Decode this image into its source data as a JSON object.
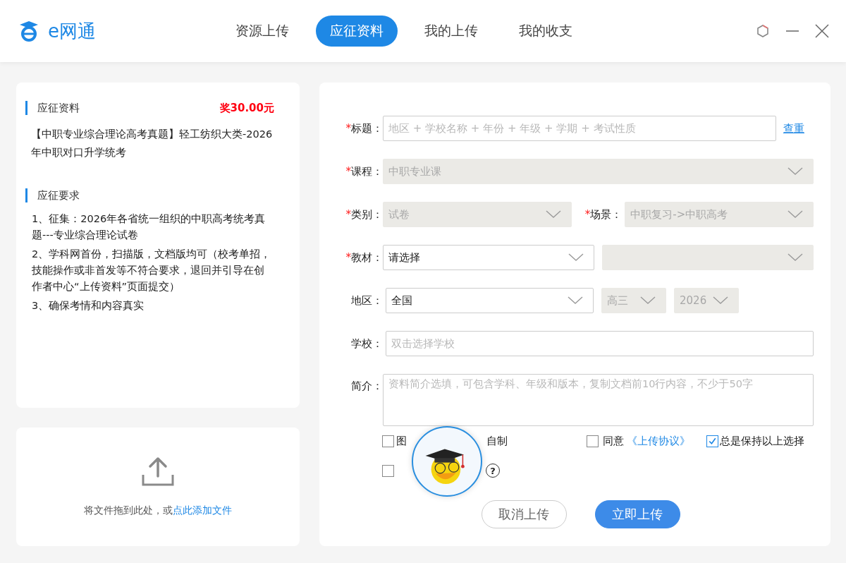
{
  "app": {
    "name": "e网通"
  },
  "nav_tabs": [
    {
      "label": "资源上传",
      "selected": false
    },
    {
      "label": "应征资料",
      "selected": true
    },
    {
      "label": "我的上传",
      "selected": false
    },
    {
      "label": "我的收支",
      "selected": false
    }
  ],
  "request": {
    "heading": "应征资料",
    "reward": "奖30.00元",
    "title": "【中职专业综合理论高考真题】轻工纺织大类-2026年中职对口升学统考",
    "requirements_heading": "应征要求",
    "requirements": [
      "1、征集：2026年各省统一组织的中职高考统考真题---专业综合理论试卷",
      "2、学科网首份，扫描版，文档版均可（校考单招，技能操作或非首发等不符合要求，退回并引导在创作者中心“上传资料”页面提交）",
      "3、确保考情和内容真实"
    ]
  },
  "upload": {
    "text": "将文件拖到此处，或",
    "link": "点此添加文件"
  },
  "form": {
    "rows": [
      {
        "fields": [
          {
            "kind": "input",
            "required_mark": "*",
            "label": "标题：",
            "placeholder": "地区 + 学校名称 + 年份 + 年级 + 学期 + 考试性质",
            "action": "查重"
          }
        ]
      },
      {
        "fields": [
          {
            "kind": "select",
            "required_mark": "*",
            "label": "课程：",
            "value": "中职专业课",
            "disabled": true
          }
        ]
      },
      {
        "fields": [
          {
            "kind": "select",
            "required_mark": "*",
            "label": "类别：",
            "value": "试卷",
            "disabled": true
          },
          {
            "kind": "select",
            "required_mark": "*",
            "label": "场景：",
            "value": "中职复习->中职高考",
            "disabled": true
          }
        ]
      },
      {
        "fields": [
          {
            "kind": "select",
            "required_mark": "*",
            "label": "教材：",
            "value": "请选择",
            "disabled": false
          },
          {
            "kind": "select",
            "disabled": true
          }
        ]
      },
      {
        "fields": [
          {
            "kind": "select",
            "label": "地区：",
            "value": "全国",
            "disabled": false
          },
          {
            "kind": "small-select",
            "value": "高三",
            "disabled": true
          },
          {
            "kind": "small-select",
            "value": "2026",
            "disabled": true
          }
        ]
      },
      {
        "fields": [
          {
            "kind": "input",
            "label": "学校：",
            "placeholder": "双击选择学校"
          }
        ]
      },
      {
        "fields": [
          {
            "kind": "textarea",
            "label": "简介：",
            "placeholder": "资料简介选填，可包含学科、年级和版本，复制文档前10行内容，不少于50字"
          }
        ]
      }
    ],
    "checkboxes": [
      {
        "kind": "split",
        "label_start": "图",
        "label_end": "自制",
        "checked": false
      },
      {
        "kind": "link",
        "label": "同意",
        "link": "《上传协议》",
        "checked": false
      },
      {
        "kind": "plain",
        "label": "总是保持以上选择",
        "checked": true
      }
    ],
    "checkboxes_row2": [
      {
        "kind": "help",
        "help_mark": "?",
        "checked": false
      }
    ],
    "buttons": [
      {
        "kind": "secondary",
        "label": "取消上传"
      },
      {
        "kind": "primary",
        "label": "立即上传"
      }
    ]
  }
}
